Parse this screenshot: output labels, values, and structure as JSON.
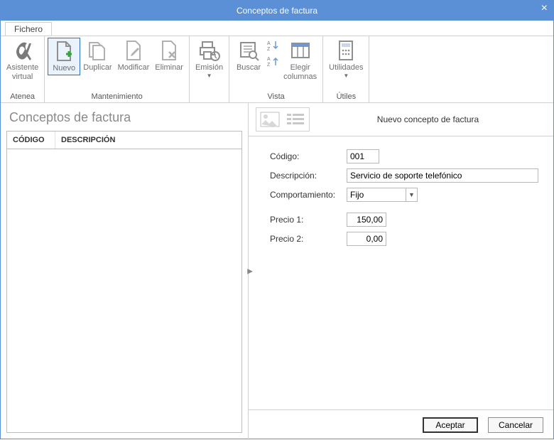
{
  "window": {
    "title": "Conceptos de factura",
    "close": "×"
  },
  "tabs": {
    "fichero": "Fichero"
  },
  "ribbon": {
    "atenea": {
      "asistente": "Asistente",
      "virtual": "virtual",
      "group": "Atenea"
    },
    "mant": {
      "nuevo": "Nuevo",
      "duplicar": "Duplicar",
      "modificar": "Modificar",
      "eliminar": "Eliminar",
      "group": "Mantenimiento"
    },
    "emision": {
      "emision": "Emisión",
      "group": " "
    },
    "vista": {
      "buscar": "Buscar",
      "elegir": "Elegir",
      "columnas": "columnas",
      "group": "Vista"
    },
    "utiles": {
      "utilidades": "Utilidades",
      "group": "Útiles"
    }
  },
  "left": {
    "heading": "Conceptos de factura",
    "col_codigo": "CÓDIGO",
    "col_desc": "DESCRIPCIÓN"
  },
  "right": {
    "title": "Nuevo concepto de factura",
    "codigo_label": "Código:",
    "codigo_value": "001",
    "desc_label": "Descripción:",
    "desc_value": "Servicio de soporte telefónico",
    "comp_label": "Comportamiento:",
    "comp_value": "Fijo",
    "p1_label": "Precio 1:",
    "p1_value": "150,00",
    "p2_label": "Precio 2:",
    "p2_value": "0,00"
  },
  "footer": {
    "aceptar": "Aceptar",
    "cancelar": "Cancelar"
  }
}
